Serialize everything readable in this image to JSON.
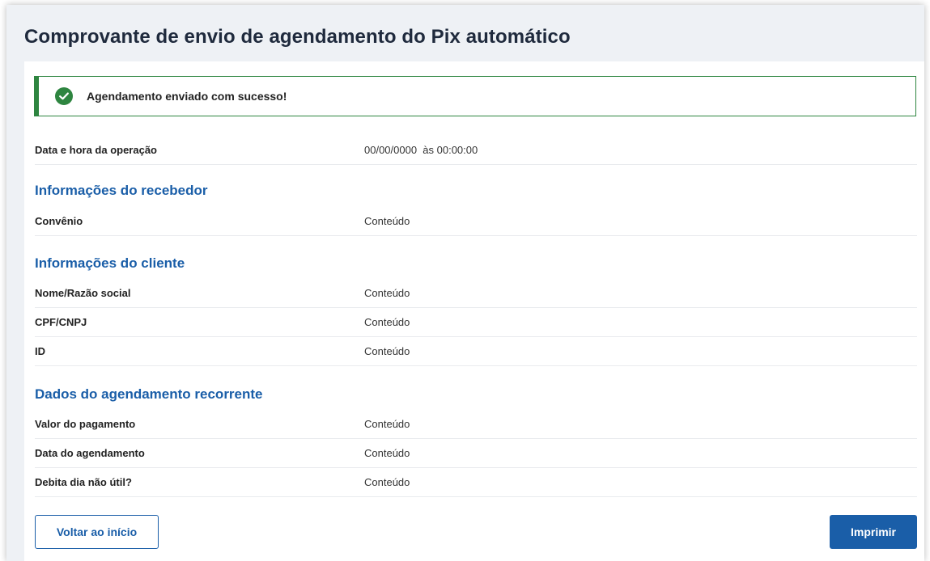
{
  "page": {
    "title": "Comprovante de envio de agendamento do Pix automático"
  },
  "alert": {
    "message": "Agendamento enviado com sucesso!",
    "icon": "check-circle-icon",
    "color": "#2e8540"
  },
  "operation": {
    "label": "Data e hora da operação",
    "value": "00/00/0000  às 00:00:00"
  },
  "sections": {
    "receiver": {
      "title": "Informações do recebedor",
      "rows": [
        {
          "label": "Convênio",
          "value": "Conteúdo"
        }
      ]
    },
    "client": {
      "title": "Informações do cliente",
      "rows": [
        {
          "label": "Nome/Razão social",
          "value": "Conteúdo"
        },
        {
          "label": "CPF/CNPJ",
          "value": "Conteúdo"
        },
        {
          "label": "ID",
          "value": "Conteúdo"
        }
      ]
    },
    "schedule": {
      "title": "Dados do agendamento recorrente",
      "rows": [
        {
          "label": "Valor do pagamento",
          "value": "Conteúdo"
        },
        {
          "label": "Data do agendamento",
          "value": "Conteúdo"
        },
        {
          "label": "Debita dia não útil?",
          "value": "Conteúdo"
        }
      ]
    }
  },
  "actions": {
    "back_label": "Voltar ao início",
    "print_label": "Imprimir"
  },
  "colors": {
    "accent": "#1a5ea8",
    "success": "#2e8540",
    "title": "#1f2a3d"
  }
}
